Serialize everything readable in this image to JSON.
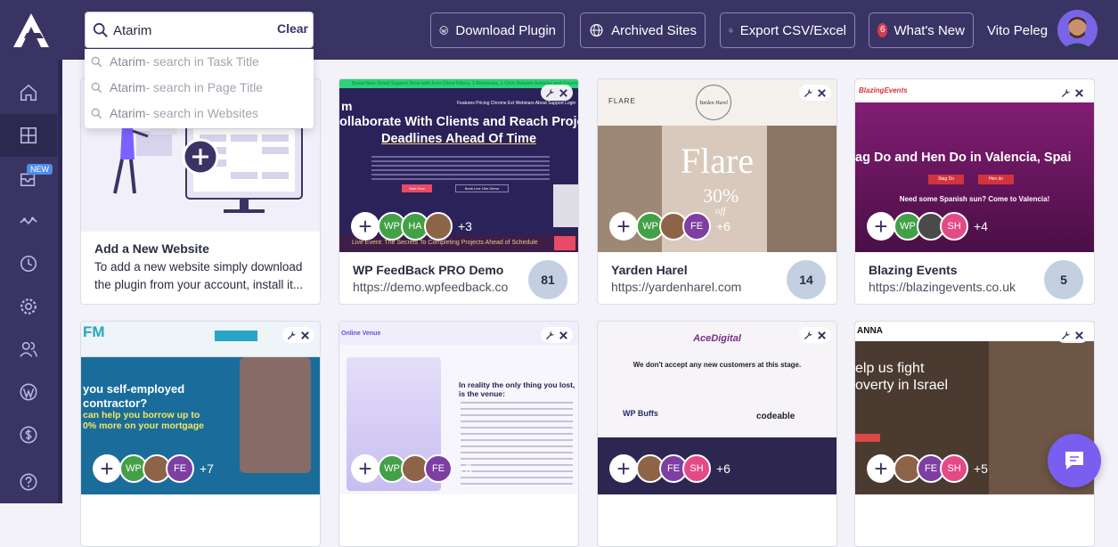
{
  "header": {
    "search_value": "Atarim",
    "clear_label": "Clear",
    "buttons": {
      "download": "Download Plugin",
      "archived": "Archived Sites",
      "export": "Export CSV/Excel",
      "whats_new": "What's New",
      "whats_new_count": "6"
    },
    "user_name": "Vito Peleg"
  },
  "search_suggestions": [
    {
      "query": "Atarim",
      "scope": " - search in Task Title"
    },
    {
      "query": "Atarim",
      "scope": " - search in Page Title"
    },
    {
      "query": "Atarim",
      "scope": " - search in Websites"
    }
  ],
  "sidebar": {
    "new_badge": "NEW",
    "items": [
      "home-icon",
      "grid-icon",
      "inbox-icon",
      "activity-icon",
      "clock-icon",
      "settings-icon",
      "users-icon",
      "wordpress-icon",
      "dollar-icon",
      "help-icon"
    ]
  },
  "add_card": {
    "title": "Add a New Website",
    "description": "To add a new website simply download the plugin from your account, install it..."
  },
  "cards": [
    {
      "title": "WP FeedBack PRO Demo",
      "url": "https://demo.wpfeedback.co",
      "count": "81",
      "avatars": [
        "WP",
        "HA"
      ],
      "more": "+3",
      "thumb": {
        "banner": "Brand New: Email Support Desk with Auto Client Filters, 1 Webhooks, 1 Click Reliable Anbieter and Grenzen",
        "h1": "ollaborate With Clients and Reach Project",
        "h2": "Deadlines Ahead Of Time",
        "nav": "Features  Pricing  Chrome Ext  Webinars  About  Support  Login",
        "btn1": "Start Free",
        "btn2": "Book Live 15m Demo",
        "strip": "Live Event: The Secrets To Completing Projects Ahead of Schedule"
      }
    },
    {
      "title": "Yarden Harel",
      "url": "https://yardenharel.com",
      "count": "14",
      "avatars": [
        "WP",
        "FE"
      ],
      "more": "+6",
      "thumb": {
        "nav": "FLARE",
        "brand": "Yarden Harel",
        "big": "Flare",
        "pct": "30%",
        "off": "off"
      }
    },
    {
      "title": "Blazing Events",
      "url": "https://blazingevents.co.uk",
      "count": "5",
      "avatars": [
        "WP",
        "SH"
      ],
      "more": "+4",
      "thumb": {
        "logo": "BlazingEvents",
        "h1": "ag Do and Hen Do in Valencia, Spai",
        "btn1": "Stag Do",
        "btn2": "Hen do",
        "sub": "Need some Spanish sun? Come to Valencia!"
      }
    },
    {
      "title": "",
      "url": "",
      "count": "",
      "avatars": [
        "WP",
        "FE"
      ],
      "more": "+7",
      "thumb": {
        "logo": "FM",
        "h1": "you self-employed",
        "h2": "contractor?",
        "h3": "can help you borrow up to",
        "h4": "0% more on your mortgage"
      }
    },
    {
      "title": "",
      "url": "",
      "count": "",
      "avatars": [
        "WP",
        "FE"
      ],
      "more": "+5",
      "thumb": {
        "logo": "Online Venue",
        "h1": "In reality the only thing you lost,",
        "h2": "is the venue:"
      }
    },
    {
      "title": "",
      "url": "",
      "count": "",
      "avatars": [
        "FE",
        "SH"
      ],
      "more": "+6",
      "thumb": {
        "logo": "AceDigital",
        "h1": "We don't accept any new customers at this stage.",
        "l1": "WP Buffs",
        "l2": "codeable"
      }
    },
    {
      "title": "",
      "url": "",
      "count": "",
      "avatars": [
        "FE",
        "SH"
      ],
      "more": "+5",
      "thumb": {
        "logo": "ANNA",
        "h1": "elp us fight",
        "h2": "overty in Israel"
      }
    }
  ]
}
